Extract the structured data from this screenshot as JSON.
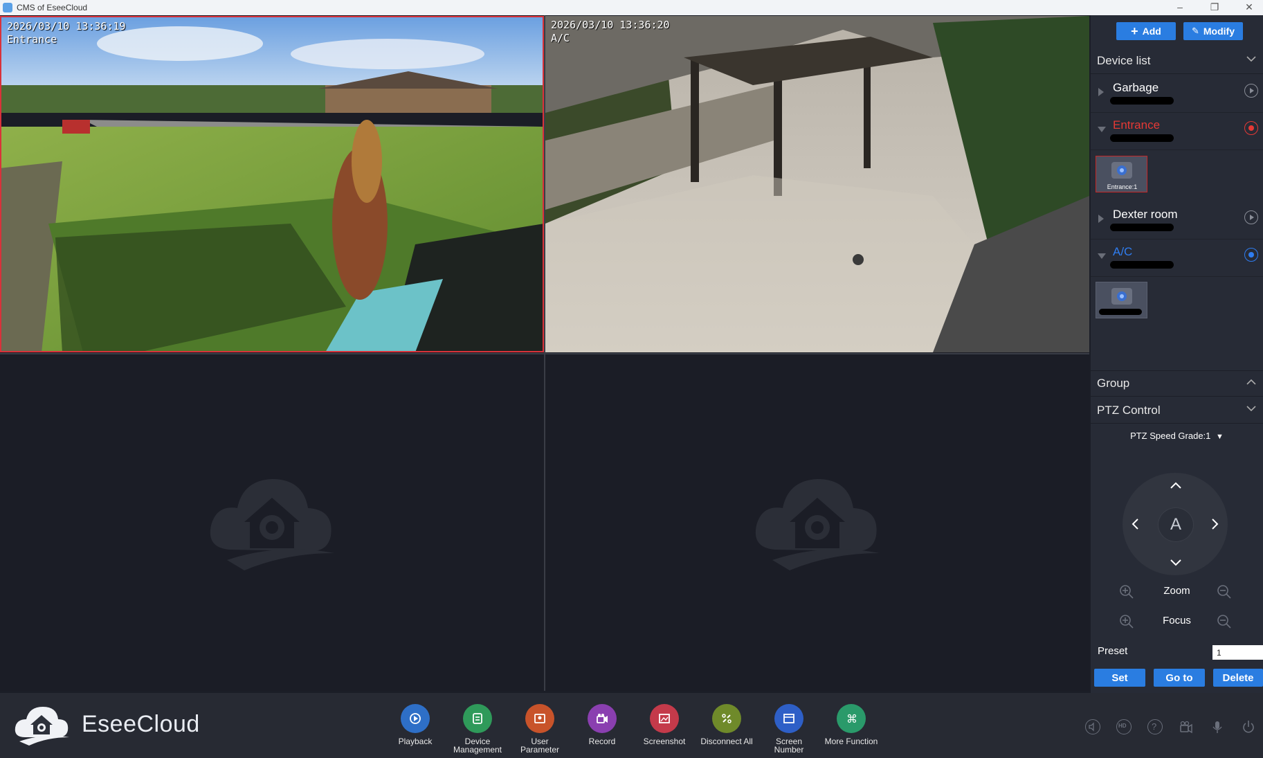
{
  "window": {
    "title": "CMS of EseeCloud"
  },
  "cameras": [
    {
      "timestamp": "2026/03/10 13:36:19",
      "name": "Entrance",
      "selected": true
    },
    {
      "timestamp": "2026/03/10 13:36:20",
      "name": "A/C",
      "selected": false
    },
    {
      "timestamp": "",
      "name": "",
      "empty": true
    },
    {
      "timestamp": "",
      "name": "",
      "empty": true
    }
  ],
  "toolbar": {
    "add_label": "Add",
    "modify_label": "Modify"
  },
  "device_list": {
    "title": "Device list",
    "devices": [
      {
        "name": "Garbage",
        "color": "#ffffff",
        "expanded": false
      },
      {
        "name": "Entrance",
        "color": "#e53935",
        "expanded": true,
        "channel": "Entrance:1"
      },
      {
        "name": "Dexter room",
        "color": "#ffffff",
        "expanded": false
      },
      {
        "name": "A/C",
        "color": "#2f7df0",
        "expanded": true
      }
    ]
  },
  "group": {
    "title": "Group"
  },
  "ptz": {
    "title": "PTZ Control",
    "speed_label": "PTZ Speed Grade:1",
    "center_label": "A",
    "zoom_label": "Zoom",
    "focus_label": "Focus",
    "preset_label": "Preset",
    "preset_value": "1",
    "set_label": "Set",
    "goto_label": "Go to",
    "delete_label": "Delete"
  },
  "brand": {
    "name": "EseeCloud"
  },
  "tools": [
    {
      "label": "Playback",
      "color": "#2e6fc7",
      "icon": "playback-icon"
    },
    {
      "label": "Device Management",
      "color": "#2f9a5a",
      "icon": "device-management-icon"
    },
    {
      "label": "User Parameter",
      "color": "#c8532a",
      "icon": "user-parameter-icon"
    },
    {
      "label": "Record",
      "color": "#8a3fb0",
      "icon": "record-icon"
    },
    {
      "label": "Screenshot",
      "color": "#c43a4a",
      "icon": "screenshot-icon"
    },
    {
      "label": "Disconnect All",
      "color": "#6f8a2a",
      "icon": "disconnect-icon"
    },
    {
      "label": "Screen Number",
      "color": "#2e5fc7",
      "icon": "screen-number-icon"
    },
    {
      "label": "More Function",
      "color": "#2a9a6a",
      "icon": "more-function-icon"
    }
  ]
}
